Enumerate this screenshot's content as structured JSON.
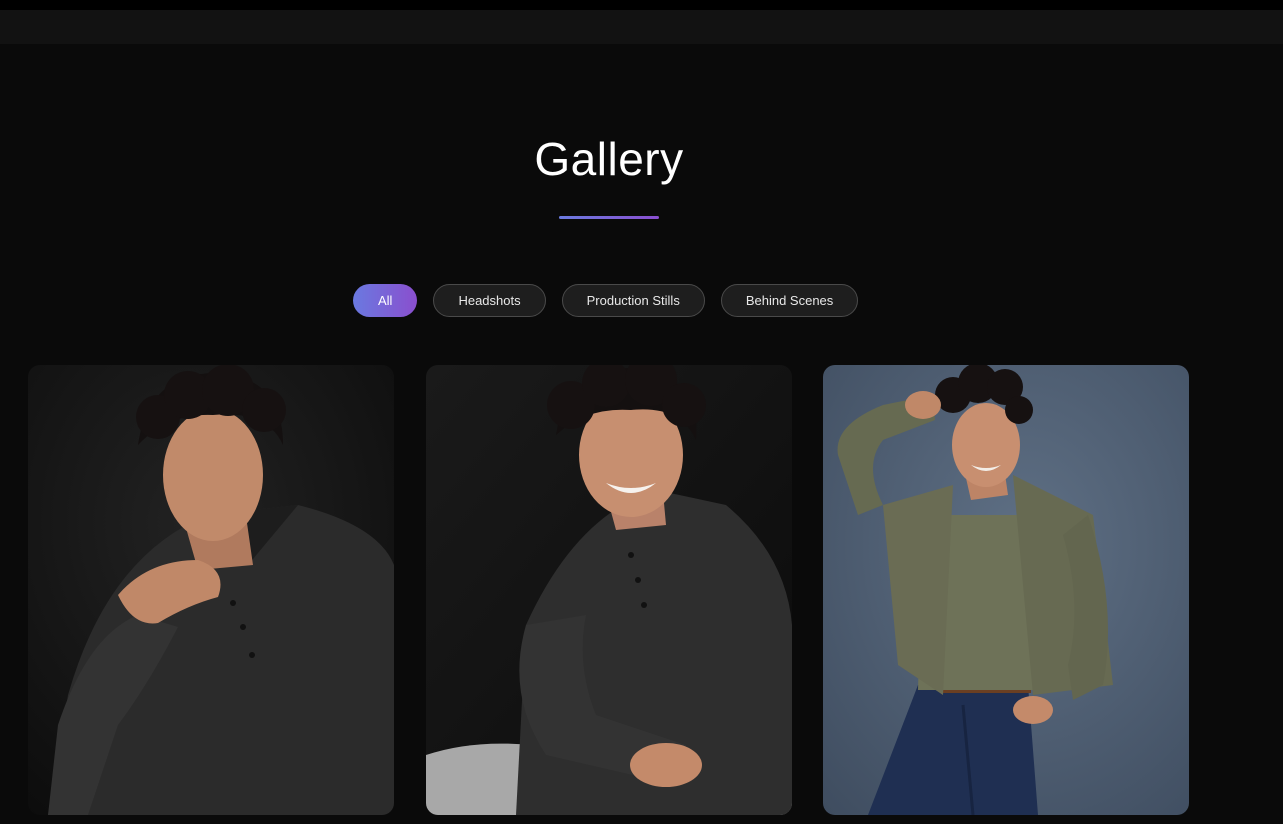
{
  "page": {
    "title": "Gallery"
  },
  "filters": [
    {
      "label": "All",
      "active": true
    },
    {
      "label": "Headshots",
      "active": false
    },
    {
      "label": "Production Stills",
      "active": false
    },
    {
      "label": "Behind Scenes",
      "active": false
    }
  ],
  "colors": {
    "background": "#0a0a0a",
    "accent_start": "#6a79e0",
    "accent_end": "#8a4fce"
  },
  "gallery": {
    "items": [
      {
        "backdrop": "dark",
        "subject": "person-black-henley-hand-on-chin"
      },
      {
        "backdrop": "dark",
        "subject": "person-black-henley-smiling-seated"
      },
      {
        "backdrop": "slate-blue",
        "subject": "person-olive-shirt-jeans-leaning"
      }
    ]
  }
}
